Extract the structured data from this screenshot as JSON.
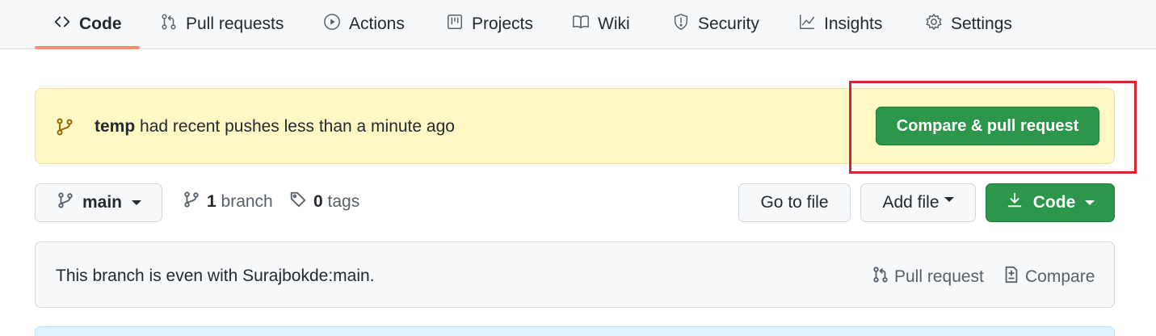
{
  "tabs": [
    {
      "label": "Code",
      "icon": "code-icon",
      "selected": true
    },
    {
      "label": "Pull requests",
      "icon": "git-pull-request-icon",
      "selected": false
    },
    {
      "label": "Actions",
      "icon": "play-icon",
      "selected": false
    },
    {
      "label": "Projects",
      "icon": "project-icon",
      "selected": false
    },
    {
      "label": "Wiki",
      "icon": "book-icon",
      "selected": false
    },
    {
      "label": "Security",
      "icon": "shield-icon",
      "selected": false
    },
    {
      "label": "Insights",
      "icon": "graph-icon",
      "selected": false
    },
    {
      "label": "Settings",
      "icon": "gear-icon",
      "selected": false
    }
  ],
  "flash": {
    "branch": "temp",
    "message": " had recent pushes less than a minute ago",
    "button_label": "Compare & pull request"
  },
  "branch_bar": {
    "current_branch": "main",
    "branch_count": "1",
    "branch_label": "branch",
    "tag_count": "0",
    "tag_label": "tags",
    "go_to_file_label": "Go to file",
    "add_file_label": "Add file",
    "code_label": "Code"
  },
  "branch_info": {
    "text": "This branch is even with Surajbokde:main.",
    "pull_request_label": "Pull request",
    "compare_label": "Compare"
  },
  "colors": {
    "primary_button": "#2c974b",
    "flash_background": "#fff8c5",
    "tab_underline": "#fd8c73",
    "highlight": "#d7262c"
  }
}
